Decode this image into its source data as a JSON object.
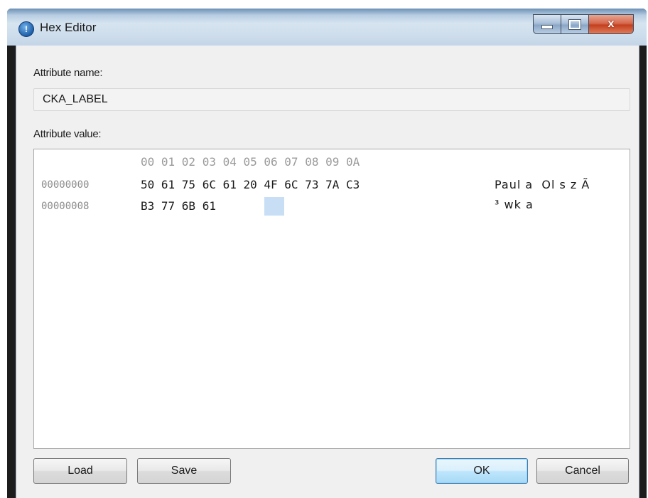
{
  "window": {
    "title": "Hex Editor"
  },
  "caption": {
    "close_glyph": "x"
  },
  "attribute_name": {
    "label": "Attribute name:",
    "value": "CKA_LABEL"
  },
  "attribute_value": {
    "label": "Attribute value:",
    "column_header": "00 01 02 03 04 05 06 07 08 09 0A",
    "rows": [
      {
        "offset": "00000000",
        "hex": "50 61 75 6C 61 20 4F 6C 73 7A C3",
        "ascii": "Paul a  Ol s z Ã"
      },
      {
        "offset": "00000008",
        "hex": "B3 77 6B 61",
        "ascii": "³ wk a"
      }
    ]
  },
  "buttons": {
    "load": "Load",
    "save": "Save",
    "ok": "OK",
    "cancel": "Cancel"
  },
  "colors": {
    "cursor_highlight": "#c7def5",
    "offset_text": "#8c8c8c",
    "default_button_border": "#3c7fb1"
  }
}
